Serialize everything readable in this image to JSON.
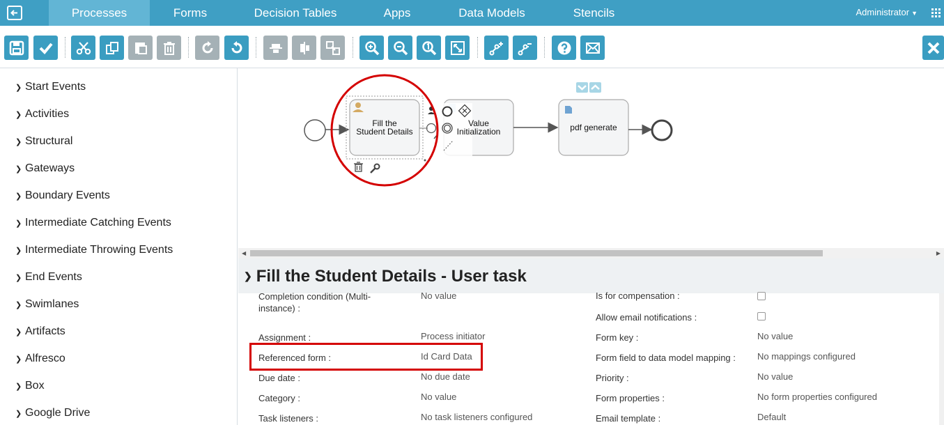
{
  "nav": {
    "tabs": [
      "Processes",
      "Forms",
      "Decision Tables",
      "Apps",
      "Data Models",
      "Stencils"
    ],
    "active_tab": "Processes",
    "user": "Administrator"
  },
  "toolbar": {
    "buttons": [
      "save",
      "validate",
      "cut",
      "copy",
      "paste",
      "delete",
      "redo",
      "undo",
      "align-horizontal",
      "align-vertical",
      "same-size",
      "zoom-in",
      "zoom-out",
      "zoom-actual",
      "zoom-fit",
      "bend-point-add",
      "bend-point-remove",
      "help",
      "feedback",
      "close"
    ]
  },
  "palette": {
    "items": [
      "Start Events",
      "Activities",
      "Structural",
      "Gateways",
      "Boundary Events",
      "Intermediate Catching Events",
      "Intermediate Throwing Events",
      "End Events",
      "Swimlanes",
      "Artifacts",
      "Alfresco",
      "Box",
      "Google Drive"
    ]
  },
  "canvas": {
    "task1": "Fill the\nStudent Details",
    "task1_line1": "Fill the",
    "task1_line2": "Student Details",
    "task2_line1": "Value",
    "task2_line2": "Initialization",
    "task3": "pdf generate"
  },
  "properties": {
    "title": "Fill the Student Details - User task",
    "left": [
      {
        "label": "Completion condition (Multi-",
        "label2": "instance) :",
        "value": "No value"
      },
      {
        "label": "Assignment :",
        "value": "Process initiator"
      },
      {
        "label": "Referenced form :",
        "value": "Id Card Data"
      },
      {
        "label": "Due date :",
        "value": "No due date"
      },
      {
        "label": "Category :",
        "value": "No value"
      },
      {
        "label": "Task listeners :",
        "value": "No task listeners configured"
      }
    ],
    "right": [
      {
        "label": "Is for compensation :",
        "value": ""
      },
      {
        "label": "Allow email notifications :",
        "value": ""
      },
      {
        "label": "Form key :",
        "value": "No value"
      },
      {
        "label": "Form field to data model mapping :",
        "value": "No mappings configured"
      },
      {
        "label": "Priority :",
        "value": "No value"
      },
      {
        "label": "Form properties :",
        "value": "No form properties configured"
      },
      {
        "label": "Email template :",
        "value": "Default"
      }
    ]
  },
  "colors": {
    "nav": "#3f9fc4",
    "button": "#3a9dc1",
    "button_disabled": "#a5b1b6",
    "highlight": "#d40000"
  }
}
